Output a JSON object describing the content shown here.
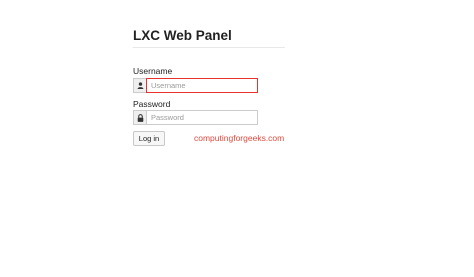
{
  "page": {
    "title": "LXC Web Panel"
  },
  "form": {
    "username_label": "Username",
    "username_placeholder": "Username",
    "password_label": "Password",
    "password_placeholder": "Password",
    "login_button": "Log in"
  },
  "icons": {
    "username": "user-icon",
    "password": "lock-icon"
  },
  "watermark": {
    "text": "computingforgeeks.com",
    "color": "#e04a3f"
  },
  "colors": {
    "focus_border": "#e9322d"
  }
}
